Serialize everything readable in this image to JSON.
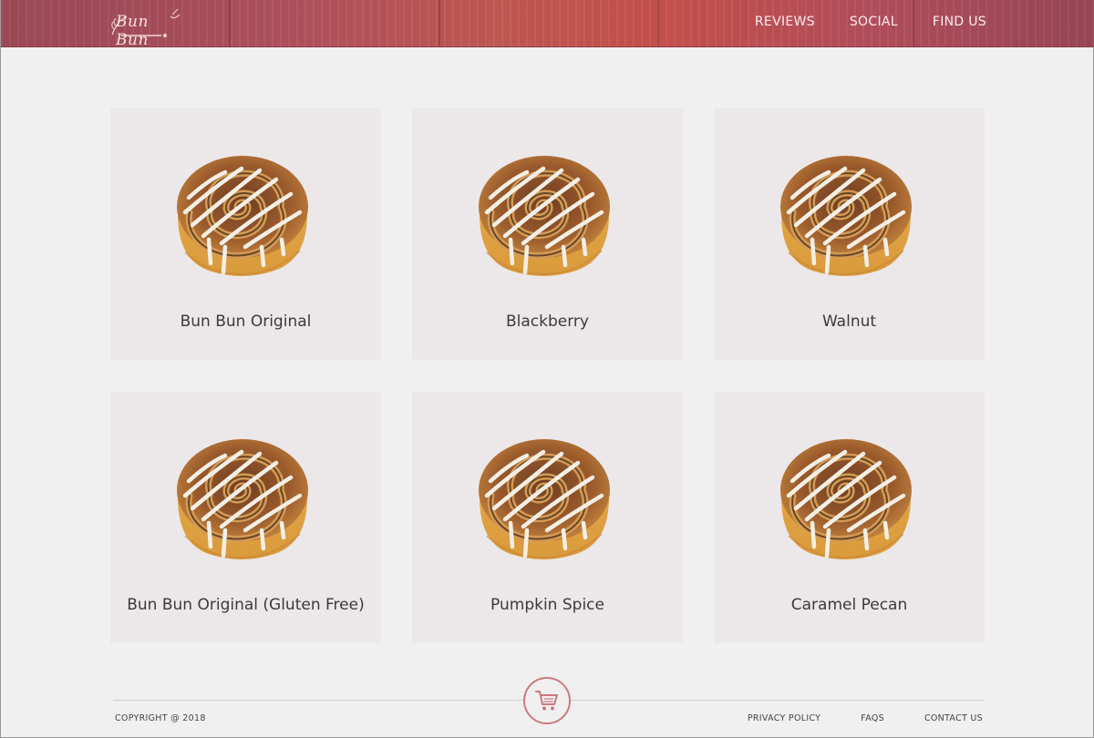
{
  "header": {
    "logo_text": "Bun Bun",
    "nav": [
      "REVIEWS",
      "SOCIAL",
      "FIND US"
    ],
    "colors": {
      "bar": "#b0525f",
      "nav_text": "#fbeeee"
    }
  },
  "products": [
    {
      "name": "Bun Bun Original"
    },
    {
      "name": "Blackberry"
    },
    {
      "name": "Walnut"
    },
    {
      "name": "Bun Bun Original (Gluten Free)"
    },
    {
      "name": "Pumpkin Spice"
    },
    {
      "name": "Caramel Pecan"
    }
  ],
  "footer": {
    "copyright": "COPYRIGHT @ 2018",
    "links": [
      "PRIVACY POLICY",
      "FAQS",
      "CONTACT US"
    ],
    "cart_icon": "shopping-cart-icon",
    "accent": "#c97a80"
  }
}
